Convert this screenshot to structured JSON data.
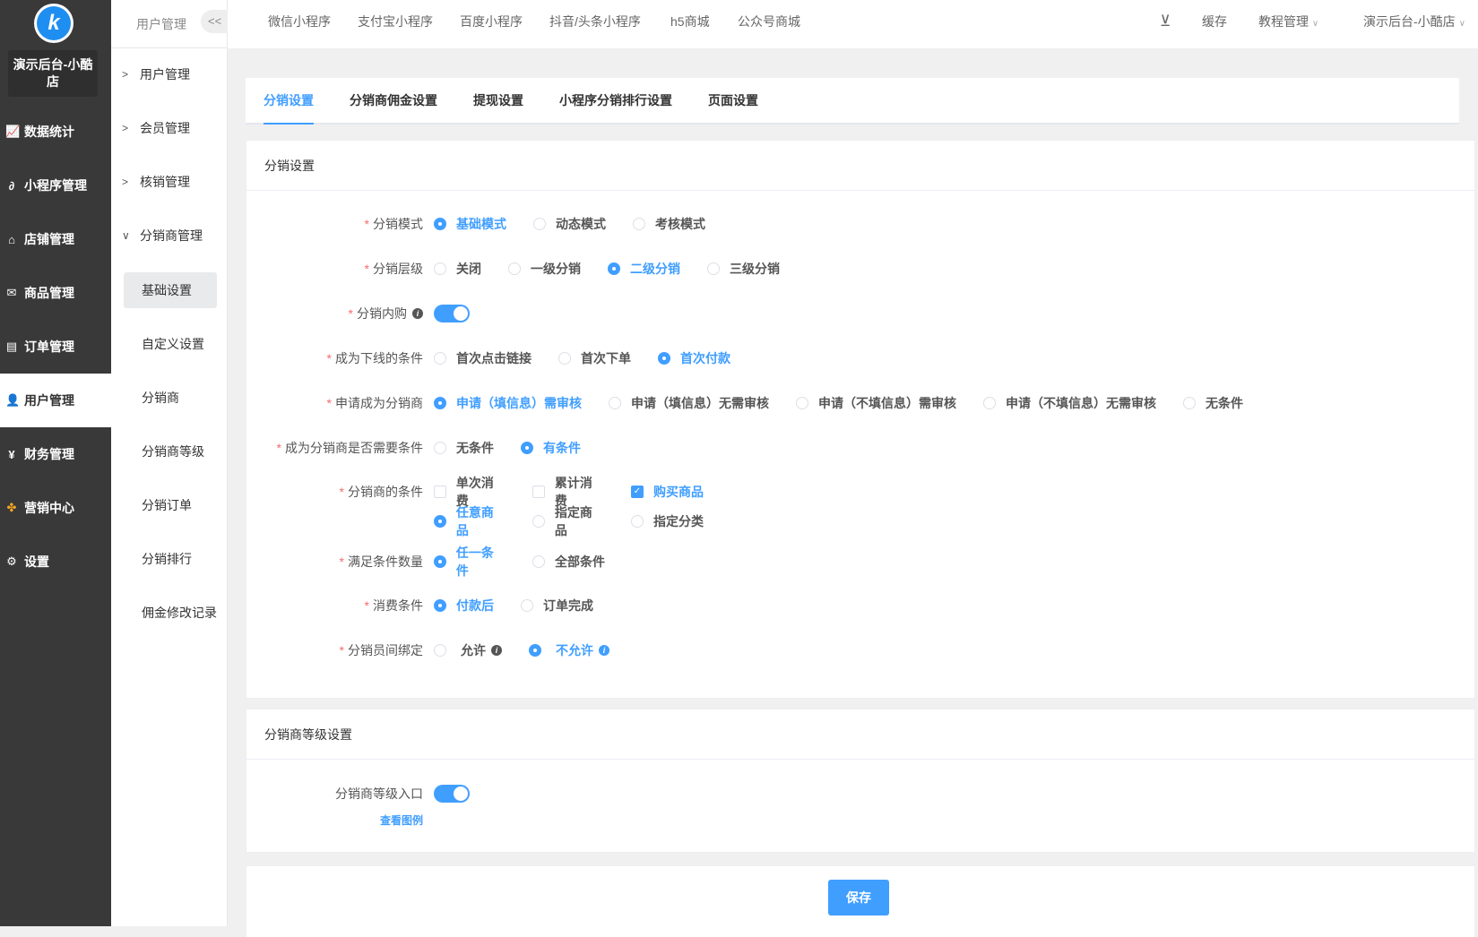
{
  "sidebar": {
    "shop_name": "演示后台-小酷店",
    "items": [
      {
        "label": "数据统计",
        "icon": "chart-icon"
      },
      {
        "label": "小程序管理",
        "icon": "link-icon"
      },
      {
        "label": "店铺管理",
        "icon": "store-icon"
      },
      {
        "label": "商品管理",
        "icon": "mail-icon"
      },
      {
        "label": "订单管理",
        "icon": "order-icon"
      },
      {
        "label": "用户管理",
        "icon": "user-icon"
      },
      {
        "label": "财务管理",
        "icon": "finance-icon"
      },
      {
        "label": "营销中心",
        "icon": "marketing-icon"
      },
      {
        "label": "设置",
        "icon": "gear-icon"
      }
    ]
  },
  "submenu": {
    "title": "用户管理",
    "collapse": "<<",
    "groups": [
      "用户管理",
      "会员管理",
      "核销管理",
      "分销商管理"
    ],
    "items": [
      "基础设置",
      "自定义设置",
      "分销商",
      "分销商等级",
      "分销订单",
      "分销排行",
      "佣金修改记录"
    ]
  },
  "topnav": {
    "items": [
      "微信小程序",
      "支付宝小程序",
      "百度小程序",
      "抖音/头条小程序",
      "h5商城",
      "公众号商城"
    ],
    "cache": "缓存",
    "tutorial": "教程管理",
    "account": "演示后台-小酷店"
  },
  "tabs": [
    "分销设置",
    "分销商佣金设置",
    "提现设置",
    "小程序分销排行设置",
    "页面设置"
  ],
  "form": {
    "title": "分销设置",
    "mode": {
      "label": "分销模式",
      "options": [
        "基础模式",
        "动态模式",
        "考核模式"
      ]
    },
    "level": {
      "label": "分销层级",
      "options": [
        "关闭",
        "一级分销",
        "二级分销",
        "三级分销"
      ]
    },
    "inner": {
      "label": "分销内购"
    },
    "downline": {
      "label": "成为下线的条件",
      "options": [
        "首次点击链接",
        "首次下单",
        "首次付款"
      ]
    },
    "apply": {
      "label": "申请成为分销商",
      "options": [
        "申请（填信息）需审核",
        "申请（填信息）无需审核",
        "申请（不填信息）需审核",
        "申请（不填信息）无需审核",
        "无条件"
      ]
    },
    "need": {
      "label": "成为分销商是否需要条件",
      "options": [
        "无条件",
        "有条件"
      ]
    },
    "cond": {
      "label": "分销商的条件",
      "checks": [
        "单次消费",
        "累计消费",
        "购买商品"
      ],
      "goods": [
        "任意商品",
        "指定商品",
        "指定分类"
      ]
    },
    "count": {
      "label": "满足条件数量",
      "options": [
        "任一条件",
        "全部条件"
      ]
    },
    "consume": {
      "label": "消费条件",
      "options": [
        "付款后",
        "订单完成"
      ]
    },
    "bind": {
      "label": "分销员间绑定",
      "options": [
        "允许",
        "不允许"
      ]
    }
  },
  "level_card": {
    "title": "分销商等级设置",
    "entry": "分销商等级入口",
    "example": "查看图例"
  },
  "save": "保存"
}
